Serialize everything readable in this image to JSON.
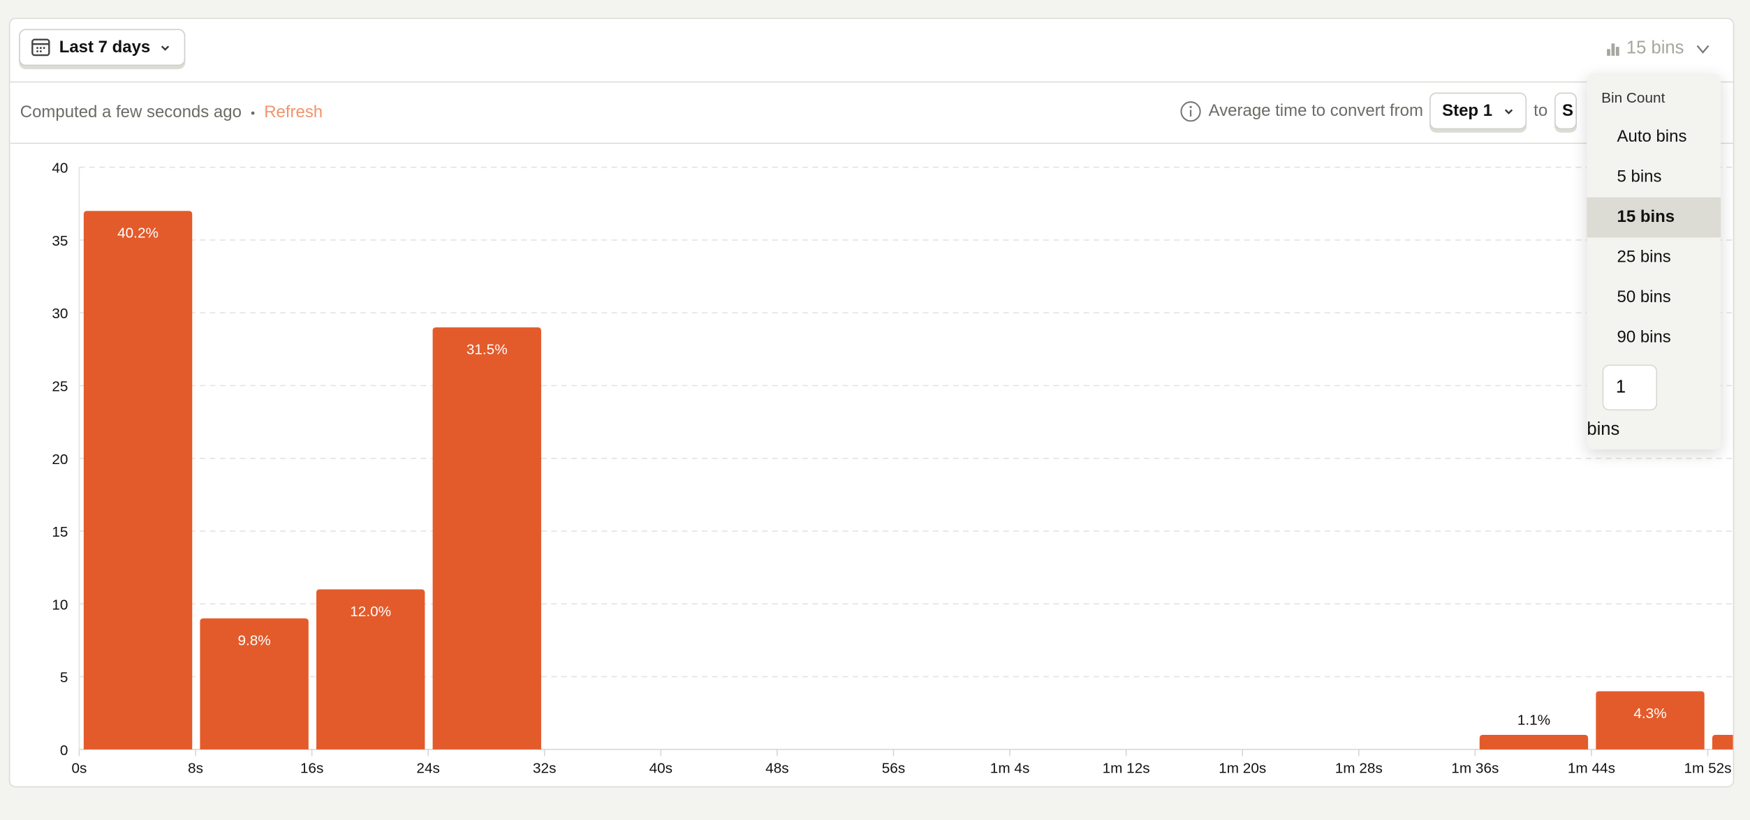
{
  "toolbar": {
    "date_range": "Last 7 days",
    "bins_toggle": "15 bins",
    "computed": "Computed a few seconds ago",
    "separator": "•",
    "refresh": "Refresh",
    "avg_label": "Average time to convert from",
    "from_step": "Step 1",
    "to_label": "to",
    "to_step_partial": "S"
  },
  "dropdown": {
    "title": "Bin Count",
    "options": [
      "Auto bins",
      "5 bins",
      "15 bins",
      "25 bins",
      "50 bins",
      "90 bins"
    ],
    "selected": "15 bins",
    "custom_value": "1",
    "custom_unit": "bins"
  },
  "colors": {
    "bar": "#e35b2b",
    "refresh": "#f0936b",
    "selected_bg": "#dcdcd5"
  },
  "chart_data": {
    "type": "bar",
    "ylim": [
      0,
      40
    ],
    "yticks": [
      "0",
      "5",
      "10",
      "15",
      "20",
      "25",
      "30",
      "35",
      "40"
    ],
    "xticks": [
      "0s",
      "8s",
      "16s",
      "24s",
      "32s",
      "40s",
      "48s",
      "56s",
      "1m 4s",
      "1m 12s",
      "1m 20s",
      "1m 28s",
      "1m 36s",
      "1m 44s",
      "1m 52s"
    ],
    "bin_seconds": 8,
    "grid": true,
    "bins": [
      {
        "start_s": 0,
        "value": 37,
        "label": "40.2%"
      },
      {
        "start_s": 8,
        "value": 9,
        "label": "9.8%"
      },
      {
        "start_s": 16,
        "value": 11,
        "label": "12.0%"
      },
      {
        "start_s": 24,
        "value": 29,
        "label": "31.5%"
      },
      {
        "start_s": 96,
        "value": 1,
        "label": "1.1%"
      },
      {
        "start_s": 104,
        "value": 4,
        "label": "4.3%"
      },
      {
        "start_s": 112,
        "value": 1,
        "label": ""
      }
    ]
  }
}
